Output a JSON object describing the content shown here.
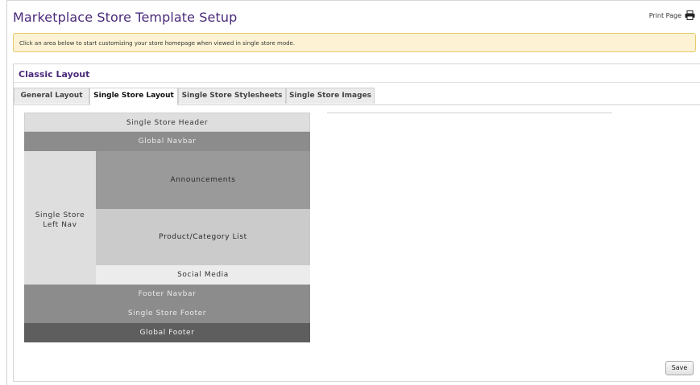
{
  "page": {
    "title": "Marketplace Store Template Setup",
    "print_label": "Print Page",
    "notice": "Click an area below to start customizing your store homepage when viewed in single store mode."
  },
  "panel": {
    "title": "Classic Layout",
    "tabs": [
      {
        "label": "General Layout",
        "active": false
      },
      {
        "label": "Single Store Layout",
        "active": true
      },
      {
        "label": "Single Store Stylesheets",
        "active": false
      },
      {
        "label": "Single Store Images",
        "active": false
      }
    ]
  },
  "layout": {
    "header": "Single Store Header",
    "global_navbar": "Global Navbar",
    "left_nav": "Single Store Left Nav",
    "announcements": "Announcements",
    "product_list": "Product/Category List",
    "social_media": "Social Media",
    "footer_navbar": "Footer Navbar",
    "single_store_footer": "Single Store Footer",
    "global_footer": "Global Footer"
  },
  "actions": {
    "save_label": "Save"
  },
  "colors": {
    "title_purple": "#4a2a7a",
    "notice_bg": "#fdf3d4",
    "notice_border": "#e8c96a"
  }
}
